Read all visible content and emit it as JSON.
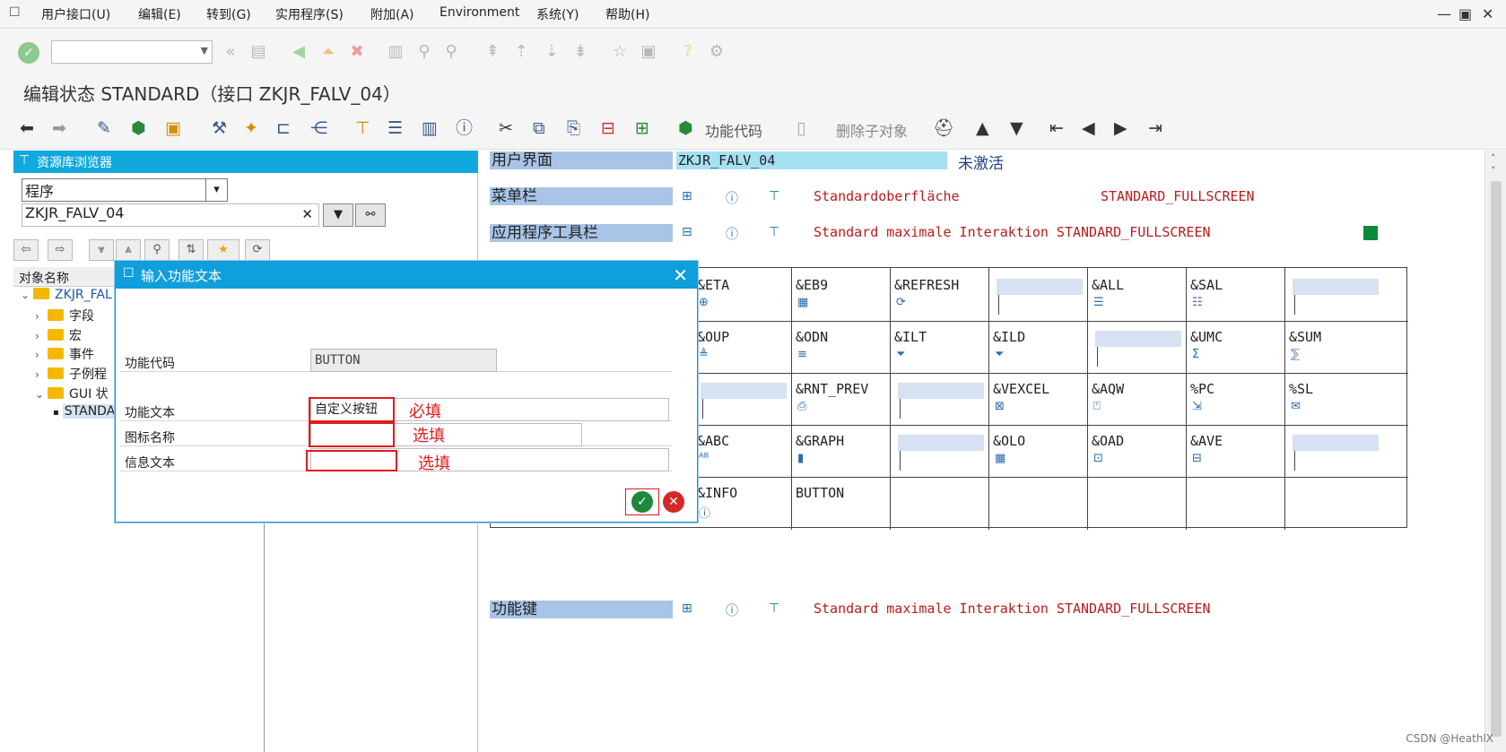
{
  "menubar": {
    "items": [
      "用户接口(U)",
      "编辑(E)",
      "转到(G)",
      "实用程序(S)",
      "附加(A)",
      "Environment",
      "系统(Y)",
      "帮助(H)"
    ]
  },
  "title": "编辑状态 STANDARD（接口 ZKJR_FALV_04）",
  "app_toolbar": {
    "function_code_label": "功能代码",
    "delete_subobject_label": "删除子对象"
  },
  "left_panel": {
    "header": "资源库浏览器",
    "object_type": "程序",
    "object_name": "ZKJR_FALV_04",
    "column_header": "对象名称",
    "tree": {
      "root": "ZKJR_FAL",
      "children": [
        "字段",
        "宏",
        "事件",
        "子例程",
        "GUI 状"
      ],
      "leaf": "STANDA"
    }
  },
  "right_pane": {
    "user_interface_label": "用户界面",
    "user_interface_value": "ZKJR_FALV_04",
    "status": "未激活",
    "menu_bar_label": "菜单栏",
    "menu_bar_text": "Standardoberfläche",
    "menu_bar_ref": "STANDARD_FULLSCREEN",
    "app_toolbar_label": "应用程序工具栏",
    "app_toolbar_text": "Standard maximale Interaktion STANDARD_FULLSCREEN",
    "function_keys_label": "功能键",
    "function_keys_text": "Standard maximale Interaktion STANDARD_FULLSCREEN",
    "grid": [
      [
        "",
        "&ETA",
        "&EB9",
        "&REFRESH",
        "",
        "&ALL",
        "&SAL",
        ""
      ],
      [
        "",
        "&OUP",
        "&ODN",
        "&ILT",
        "&ILD",
        "",
        "&UMC",
        "&SUM"
      ],
      [
        "",
        "",
        "&RNT_PREV",
        "",
        "&VEXCEL",
        "&AQW",
        "%PC",
        "%SL"
      ],
      [
        "",
        "&ABC",
        "&GRAPH",
        "",
        "&OLO",
        "&OAD",
        "&AVE",
        ""
      ],
      [
        "",
        "&INFO",
        "BUTTON",
        "",
        "",
        "",
        "",
        ""
      ]
    ]
  },
  "dialog": {
    "title": "输入功能文本",
    "function_code_label": "功能代码",
    "function_code_value": "BUTTON",
    "function_text_label": "功能文本",
    "function_text_value": "自定义按钮",
    "icon_name_label": "图标名称",
    "icon_name_value": "",
    "info_text_label": "信息文本",
    "info_text_value": "",
    "annot_required": "必填",
    "annot_optional_1": "选填",
    "annot_optional_2": "选填"
  },
  "watermark": "CSDN @HeathlX"
}
